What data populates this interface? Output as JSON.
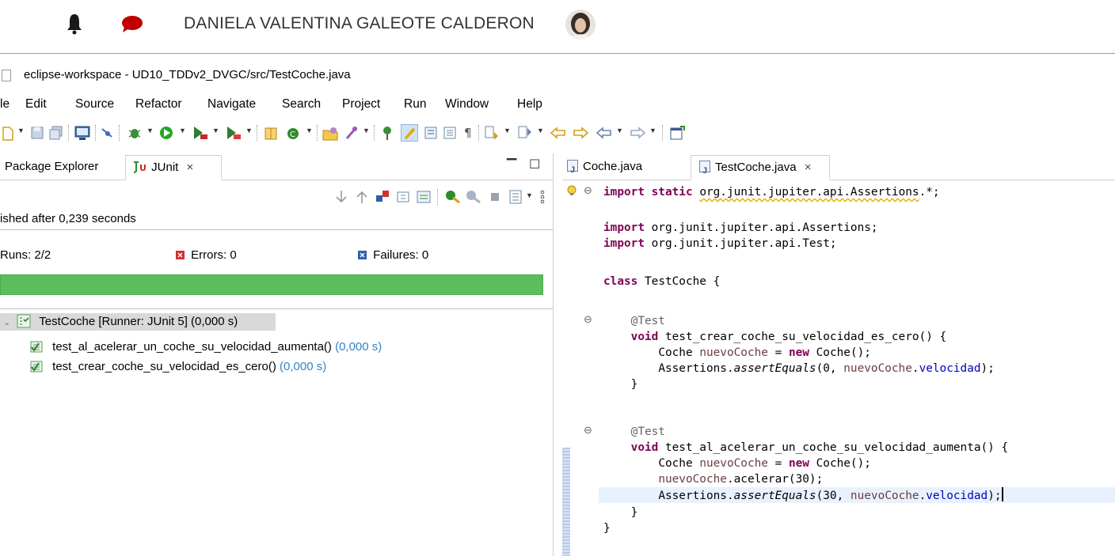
{
  "topbar": {
    "user_name": "DANIELA VALENTINA GALEOTE CALDERON",
    "icons": [
      "bell-icon",
      "chat-icon"
    ],
    "accent_color": "#c00000"
  },
  "window": {
    "title": "eclipse-workspace - UD10_TDDv2_DVGC/src/TestCoche.java"
  },
  "menu": {
    "items": [
      "le",
      "Edit",
      "Source",
      "Refactor",
      "Navigate",
      "Search",
      "Project",
      "Run",
      "Window",
      "Help"
    ]
  },
  "left_panel": {
    "tabs": [
      {
        "label": "Package Explorer"
      },
      {
        "label": "JUnit",
        "close": "×"
      }
    ],
    "finished_text": "ished after 0,239 seconds",
    "runs_label": "Runs:",
    "runs_value": "2/2",
    "errors_label": "Errors:",
    "errors_value": "0",
    "failures_label": "Failures:",
    "failures_value": "0",
    "progress_fraction": 1.0,
    "progress_color": "#5cbd5c",
    "tree": {
      "root": {
        "label": "TestCoche [Runner: JUnit 5] (0,000 s)"
      },
      "children": [
        {
          "label": "test_al_acelerar_un_coche_su_velocidad_aumenta()",
          "time": "(0,000 s)"
        },
        {
          "label": "test_crear_coche_su_velocidad_es_cero()",
          "time": "(0,000 s)"
        }
      ]
    }
  },
  "editor": {
    "tabs": [
      {
        "label": "Coche.java"
      },
      {
        "label": "TestCoche.java",
        "close": "×"
      }
    ],
    "code": {
      "l1_kw": "import static",
      "l1_pkg": "org.junit.jupiter.api.Assertions",
      "l1_rest": ".*;",
      "l2_kw": "import",
      "l2_rest": " org.junit.jupiter.api.Assertions;",
      "l3_kw": "import",
      "l3_rest": " org.junit.jupiter.api.Test;",
      "l4_kw": "class",
      "l4_rest": " TestCoche {",
      "ann": "@Test",
      "void": "void",
      "m1_sig": " test_crear_coche_su_velocidad_es_cero() {",
      "coche": "Coche",
      "nuevo": "nuevoCoche",
      "eq_new": " = ",
      "new": "new",
      "ctor": " Coche();",
      "assertions": "Assertions.",
      "assertEquals": "assertEquals",
      "a1_open": "(0, ",
      "dot": ".",
      "velocidad": "velocidad",
      "close_paren": ");",
      "brace_close": "}",
      "m2_sig": " test_al_acelerar_un_coche_su_velocidad_aumenta() {",
      "acelerar": ".acelerar(30);",
      "a2_open": "(30, "
    }
  }
}
